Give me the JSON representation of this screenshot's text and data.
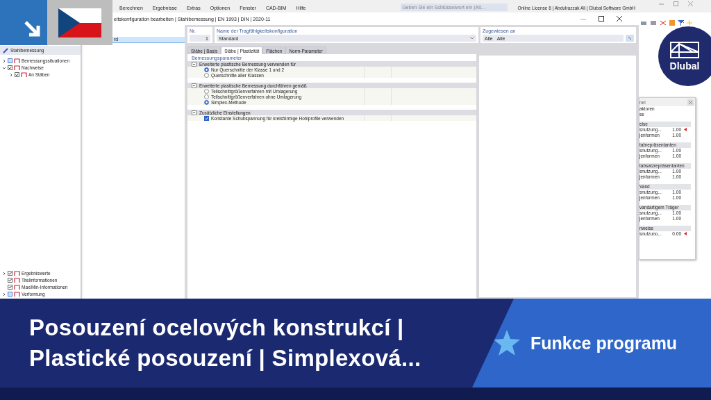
{
  "menu": [
    "Berechnen",
    "Ergebnisse",
    "Extras",
    "Optionen",
    "Fenster",
    "CAD-BIM",
    "Hilfe"
  ],
  "search": {
    "placeholder": "Geben Sie ein Schlüsselwort ein (Alt..."
  },
  "license": "Online License 6 | Abdulrazzak Ali | Dlubal Software GmbH",
  "navigator": {
    "title": "Stahlbemessung",
    "tree": [
      {
        "label": "Bemessungssituationen",
        "kind": "group",
        "expanded": false,
        "checked": false
      },
      {
        "label": "Nachweise",
        "kind": "group",
        "expanded": true,
        "checked": true,
        "children": [
          {
            "label": "An Stäben",
            "kind": "group",
            "expanded": false,
            "checked": true
          }
        ]
      }
    ],
    "display": [
      {
        "label": "Ergebniswerte",
        "kind": "group",
        "expanded": false,
        "checked": true
      },
      {
        "label": "Titelinformationen",
        "kind": "leaf",
        "checked": true
      },
      {
        "label": "Max/Min-Informationen",
        "kind": "leaf",
        "checked": true
      },
      {
        "label": "Verformung",
        "kind": "group",
        "expanded": false,
        "checked": false
      }
    ]
  },
  "dialog": {
    "title": "eitskonfiguration bearbeiten | Stahlbemessung | EN 1993 | DIN | 2020-11",
    "list": [
      {
        "label": "rd",
        "selected": true
      }
    ],
    "number": {
      "label": "Nr.",
      "value": "1"
    },
    "name": {
      "label": "Name der Tragfähigkeitskonfiguration",
      "value": "Standard"
    },
    "assigned": {
      "label": "Zugewiesen an",
      "values": [
        "Alle",
        "Alle"
      ]
    },
    "tabs": [
      {
        "label": "Stäbe | Basis",
        "selected": false
      },
      {
        "label": "Stäbe | Plastizität",
        "selected": true
      },
      {
        "label": "Flächen",
        "selected": false
      },
      {
        "label": "Norm-Parameter",
        "selected": false
      }
    ],
    "section": "Bemessungsparameter",
    "groups": [
      {
        "title": "Erweiterte plastische Bemessung verwenden für",
        "expanded": true,
        "options": [
          {
            "kind": "radio",
            "label": "Nur Querschnitte der Klasse 1 und 2",
            "selected": true
          },
          {
            "kind": "radio",
            "label": "Querschnitte aller Klassen",
            "selected": false
          }
        ]
      },
      {
        "title": "Erweiterte plastische Bemessung durchführen gemäß",
        "expanded": true,
        "options": [
          {
            "kind": "radio",
            "label": "Teilschnittgrößenverfahren mit Umlagerung",
            "selected": false
          },
          {
            "kind": "radio",
            "label": "Teilschnittgrößenverfahren ohne Umlagerung",
            "selected": false
          },
          {
            "kind": "radio",
            "label": "Simplex-Methode",
            "selected": true
          }
        ]
      },
      {
        "title": "Zusätzliche Einstellungen",
        "expanded": true,
        "options": [
          {
            "kind": "checkbox",
            "label": "Konstante Schubspannung für kreisförmige Hohlprofile verwenden",
            "checked": true
          }
        ]
      }
    ]
  },
  "side_panel": {
    "title": "nel",
    "lines": [
      "aktoren",
      "se"
    ],
    "groups": [
      {
        "title": "eise",
        "rows": [
          {
            "label": "snutzung...",
            "value": "1.00",
            "warning": true
          },
          {
            "label": "jenformen",
            "value": "1.00",
            "warning": false
          }
        ]
      },
      {
        "title": "tabrepräsentanten",
        "rows": [
          {
            "label": "snutzung...",
            "value": "1.00",
            "warning": false
          },
          {
            "label": "jenformen",
            "value": "1.00",
            "warning": false
          }
        ]
      },
      {
        "title": "tabsatzrepräsentanten",
        "rows": [
          {
            "label": "snutzung...",
            "value": "1.00",
            "warning": false
          },
          {
            "label": "jenformen",
            "value": "1.00",
            "warning": false
          }
        ]
      },
      {
        "title": "Vand",
        "rows": [
          {
            "label": "snutzung...",
            "value": "1.00",
            "warning": false
          },
          {
            "label": "jenformen",
            "value": "1.00",
            "warning": false
          }
        ]
      },
      {
        "title": "vandartigem Träger",
        "rows": [
          {
            "label": "snutzung...",
            "value": "1.00",
            "warning": false
          },
          {
            "label": "jenformen",
            "value": "1.00",
            "warning": false
          }
        ]
      },
      {
        "title": "nweise",
        "rows": [
          {
            "label": "snutzuno...",
            "value": "0.00",
            "warning": true
          }
        ]
      }
    ]
  },
  "logo": "Dlubal",
  "banner": {
    "title_lines": [
      "Posouzení ocelových konstrukcí |",
      "Plastické posouzení | Simplexová..."
    ],
    "badge": "Funkce programu"
  }
}
